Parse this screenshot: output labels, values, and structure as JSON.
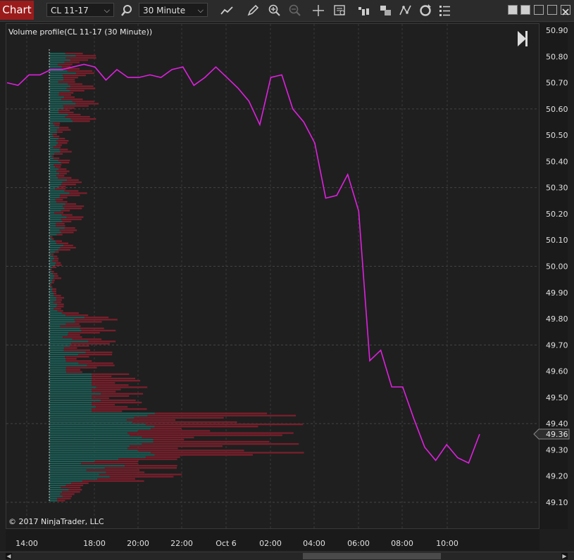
{
  "toolbar": {
    "tab_label": "Chart",
    "instrument": "CL 11-17",
    "interval": "30 Minute",
    "icons": [
      "search-icon",
      "line-chart-icon",
      "pencil-icon",
      "zoom-in-icon",
      "zoom-out-icon",
      "crosshair-icon",
      "data-box-icon",
      "bar-type-icon",
      "layers-icon",
      "indicators-icon",
      "refresh-icon",
      "list-icon"
    ],
    "window_buttons": [
      "tile-icon",
      "tile-icon",
      "minimize-icon",
      "maximize-icon",
      "close-icon"
    ]
  },
  "chart": {
    "indicator_label": "Volume profile(CL 11-17 (30 Minute))",
    "copyright": "© 2017 NinjaTrader, LLC",
    "current_price_label": "49.36",
    "line_color": "#e020e0",
    "bar_color_buy": "#1d5c55",
    "bar_color_sell": "#7a1f2b"
  },
  "chart_data": {
    "type": "line",
    "price_axis_ticks": [
      "50.90",
      "50.80",
      "50.70",
      "50.60",
      "50.50",
      "50.40",
      "50.30",
      "50.20",
      "50.10",
      "50.00",
      "49.90",
      "49.80",
      "49.70",
      "49.60",
      "49.50",
      "49.40",
      "49.36",
      "49.30",
      "49.20",
      "49.10"
    ],
    "time_axis_ticks": [
      "14:00",
      "18:00",
      "20:00",
      "22:00",
      "Oct 6",
      "02:00",
      "04:00",
      "06:00",
      "08:00",
      "10:00"
    ],
    "ylim": [
      49.05,
      50.92
    ],
    "grid": true,
    "series": [
      {
        "values": [
          50.7,
          50.69,
          50.73,
          50.73,
          50.75,
          50.75,
          50.76,
          50.77,
          50.76,
          50.71,
          50.75,
          50.72,
          50.72,
          50.73,
          50.72,
          50.75,
          50.76,
          50.69,
          50.72,
          50.76,
          50.72,
          50.68,
          50.63,
          50.54,
          50.72,
          50.73,
          50.6,
          50.55,
          50.47,
          50.26,
          50.27,
          50.35,
          50.21,
          49.64,
          49.68,
          49.54,
          49.54,
          49.42,
          49.31,
          49.26,
          49.32,
          49.27,
          49.25,
          49.36
        ]
      }
    ]
  }
}
